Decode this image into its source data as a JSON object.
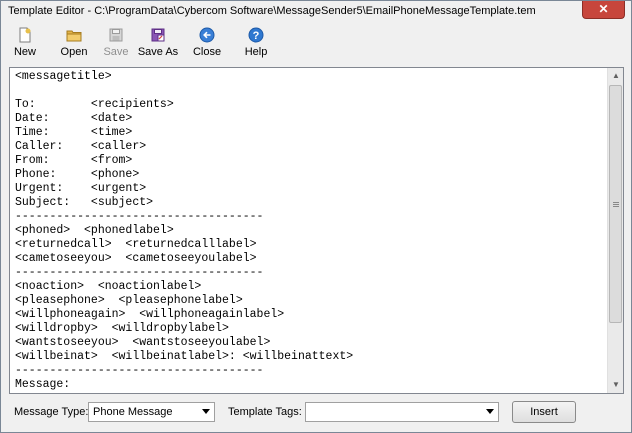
{
  "window": {
    "title": "Template Editor - C:\\ProgramData\\Cybercom Software\\MessageSender5\\EmailPhoneMessageTemplate.tem",
    "close_glyph": "✕"
  },
  "toolbar": {
    "new_label": "New",
    "open_label": "Open",
    "save_label": "Save",
    "save_as_label": "Save As",
    "close_label": "Close",
    "help_label": "Help"
  },
  "editor": {
    "content": "<messagetitle>\n\nTo:        <recipients>\nDate:      <date>\nTime:      <time>\nCaller:    <caller>\nFrom:      <from>\nPhone:     <phone>\nUrgent:    <urgent>\nSubject:   <subject>\n------------------------------------\n<phoned>  <phonedlabel>\n<returnedcall>  <returnedcalllabel>\n<cametoseeyou>  <cametoseeyoulabel>\n------------------------------------\n<noaction>  <noactionlabel>\n<pleasephone>  <pleasephonelabel>\n<willphoneagain>  <willphoneagainlabel>\n<willdropby>  <willdropbylabel>\n<wantstoseeyou>  <wantstoseeyoulabel>\n<willbeinat>  <willbeinatlabel>: <willbeinattext>\n------------------------------------\nMessage:"
  },
  "bottom": {
    "message_type_label": "Message Type:",
    "message_type_value": "Phone Message",
    "template_tags_label": "Template Tags:",
    "template_tags_value": "",
    "insert_label": "Insert"
  },
  "colors": {
    "close_button": "#c7463c",
    "new_icon": "#d9a441",
    "open_icon": "#e3b44a",
    "save_as_icon": "#7a3fa3",
    "close_icon": "#2a6fc9",
    "help_icon": "#2a6fc9"
  }
}
